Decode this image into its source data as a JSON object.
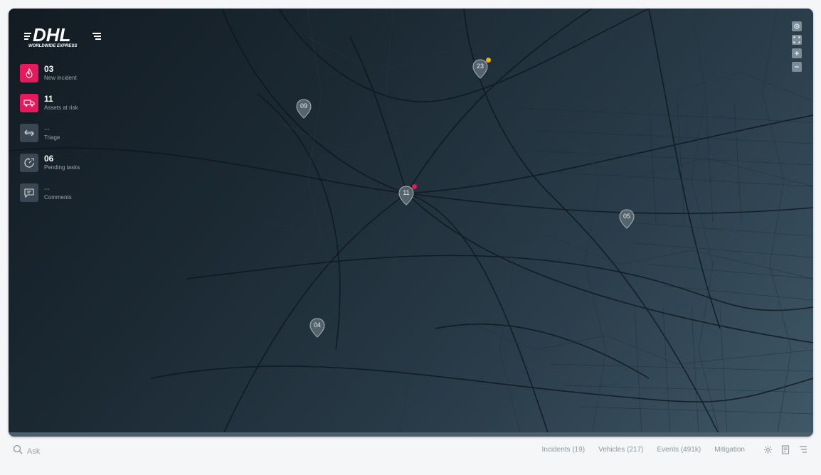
{
  "brand": {
    "name": "DHL",
    "tagline": "WORLDWIDE EXPRESS"
  },
  "stats": [
    {
      "icon": "fire-icon",
      "value": "03",
      "label": "New incident",
      "style": "pink"
    },
    {
      "icon": "truck-icon",
      "value": "11",
      "label": "Assets at risk",
      "style": "pink"
    },
    {
      "icon": "swap-arrows-icon",
      "value": "--",
      "label": "Triage",
      "style": "gray"
    },
    {
      "icon": "timer-icon",
      "value": "06",
      "label": "Pending tasks",
      "style": "gray"
    },
    {
      "icon": "comment-icon",
      "value": "--",
      "label": "Comments",
      "style": "gray"
    }
  ],
  "map_controls": [
    "settings-icon",
    "fullscreen-icon",
    "zoom-in-icon",
    "zoom-out-icon"
  ],
  "markers": [
    {
      "label": "23",
      "alert": "#f5b000"
    },
    {
      "label": "09",
      "alert": null
    },
    {
      "label": "11",
      "alert": "#e5195c"
    },
    {
      "label": "05",
      "alert": null
    },
    {
      "label": "04",
      "alert": null
    }
  ],
  "bottom": {
    "ask_placeholder": "Ask",
    "filters": [
      "Incidents (19)",
      "Vehicles (217)",
      "Events (491k)",
      "Mitigation"
    ],
    "tools": [
      "gear-icon",
      "document-icon",
      "list-icon"
    ]
  },
  "colors": {
    "accent": "#e5195c",
    "warning": "#f5b000",
    "map_dark": "#121b22",
    "map_light": "#3f5867"
  }
}
